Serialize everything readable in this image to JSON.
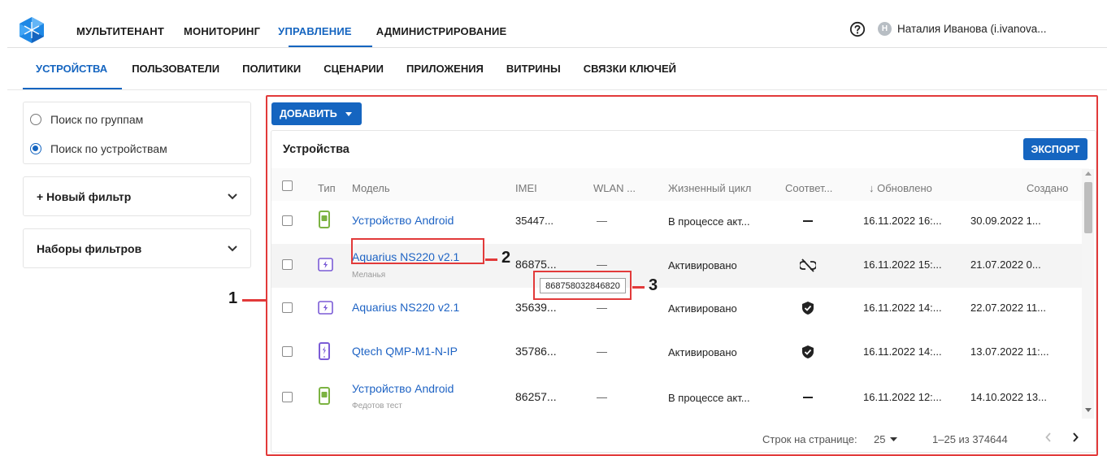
{
  "topnav": {
    "items": [
      "МУЛЬТИТЕНАНТ",
      "МОНИТОРИНГ",
      "УПРАВЛЕНИЕ",
      "АДМИНИСТРИРОВАНИЕ"
    ],
    "active_index": 2
  },
  "user": {
    "initial": "Н",
    "name": "Наталия Иванова (i.ivanova..."
  },
  "subtabs": {
    "items": [
      "УСТРОЙСТВА",
      "ПОЛЬЗОВАТЕЛИ",
      "ПОЛИТИКИ",
      "СЦЕНАРИИ",
      "ПРИЛОЖЕНИЯ",
      "ВИТРИНЫ",
      "СВЯЗКИ КЛЮЧЕЙ"
    ],
    "active_index": 0
  },
  "sidebar": {
    "search_mode": [
      {
        "label": "Поиск по группам",
        "selected": false
      },
      {
        "label": "Поиск по устройствам",
        "selected": true
      }
    ],
    "new_filter": "+ Новый фильтр",
    "filter_sets": "Наборы фильтров"
  },
  "main": {
    "add_label": "ДОБАВИТЬ",
    "card_title": "Устройства",
    "export_label": "ЭКСПОРТ",
    "columns": [
      "Тип",
      "Модель",
      "IMEI",
      "WLAN ...",
      "Жизненный цикл",
      "Соответ...",
      "↓ Обновлено",
      "Создано"
    ],
    "rows": [
      {
        "type_icon": "android-phone-icon",
        "model": "Устройство Android",
        "sub": "",
        "imei": "35447...",
        "wlan": "—",
        "lifecycle": "В процессе акт...",
        "compliance": "dash",
        "updated": "16.11.2022 16:...",
        "created": "30.09.2022 1..."
      },
      {
        "type_icon": "tablet-icon",
        "model": "Aquarius NS220 v2.1",
        "sub": "Меланья",
        "imei": "86875...",
        "wlan": "—",
        "lifecycle": "Активировано",
        "compliance": "unlinked-icon",
        "updated": "16.11.2022 15:...",
        "created": "21.07.2022 0..."
      },
      {
        "type_icon": "tablet-icon",
        "model": "Aquarius NS220 v2.1",
        "sub": "",
        "imei": "35639...",
        "wlan": "—",
        "lifecycle": "Активировано",
        "compliance": "shield-check-icon",
        "updated": "16.11.2022 14:...",
        "created": "22.07.2022 11..."
      },
      {
        "type_icon": "phone-icon",
        "model": "Qtech QMP-M1-N-IP",
        "sub": "",
        "imei": "35786...",
        "wlan": "—",
        "lifecycle": "Активировано",
        "compliance": "shield-check-icon",
        "updated": "16.11.2022 14:...",
        "created": "13.07.2022 11:..."
      },
      {
        "type_icon": "android-phone-icon",
        "model": "Устройство Android",
        "sub": "Федотов тест",
        "imei": "86257...",
        "wlan": "—",
        "lifecycle": "В процессе акт...",
        "compliance": "dash",
        "updated": "16.11.2022 12:...",
        "created": "14.10.2022 13..."
      }
    ],
    "tooltip": "868758032846820",
    "pagination": {
      "rows_per_page_label": "Строк на странице:",
      "rows_per_page": "25",
      "range": "1–25 из 374644"
    }
  },
  "annotations": [
    "1",
    "2",
    "3"
  ],
  "colors": {
    "accent": "#1565c0",
    "annotation": "#e23a3a",
    "android_green": "#7cb342",
    "tablet_purple": "#7b5cd6"
  }
}
